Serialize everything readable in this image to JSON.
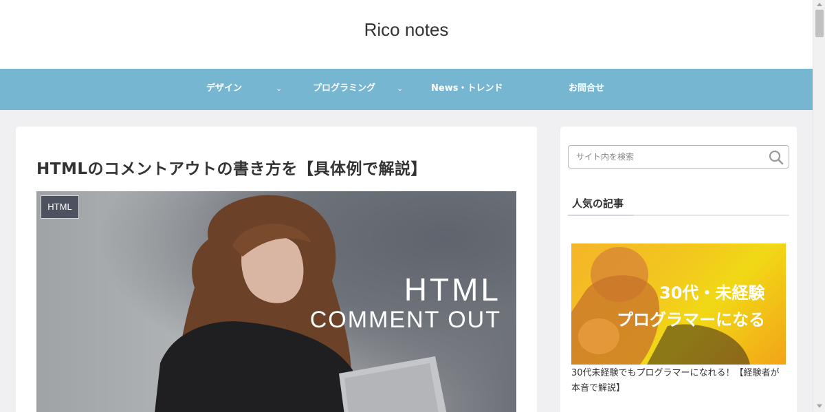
{
  "site": {
    "title": "Rico notes"
  },
  "nav": {
    "items": [
      {
        "label": "デザイン",
        "has_dropdown": true
      },
      {
        "label": "プログラミング",
        "has_dropdown": true
      },
      {
        "label": "News・トレンド",
        "has_dropdown": false
      },
      {
        "label": "お問合せ",
        "has_dropdown": false
      }
    ],
    "chevron": "⌄"
  },
  "article": {
    "title": "HTMLのコメントアウトの書き方を【具体例で解説】",
    "category": "HTML",
    "hero_line1": "HTML",
    "hero_line2": "COMMENT OUT"
  },
  "sidebar": {
    "search": {
      "placeholder": "サイト内を検索",
      "value": ""
    },
    "widget_title": "人気の記事",
    "popular": [
      {
        "thumb_line1": "30代・未経験",
        "thumb_line2": "プログラマーになる",
        "title": "30代未経験でもプログラマーになれる！【経験者が本音で解説】"
      }
    ]
  },
  "colors": {
    "nav_bg": "#76b6d1",
    "page_bg": "#f0f0f2",
    "badge_bg": "#4d5260",
    "thumb_yellow": "#f2c81d"
  },
  "icons": {
    "search": "search-icon"
  }
}
